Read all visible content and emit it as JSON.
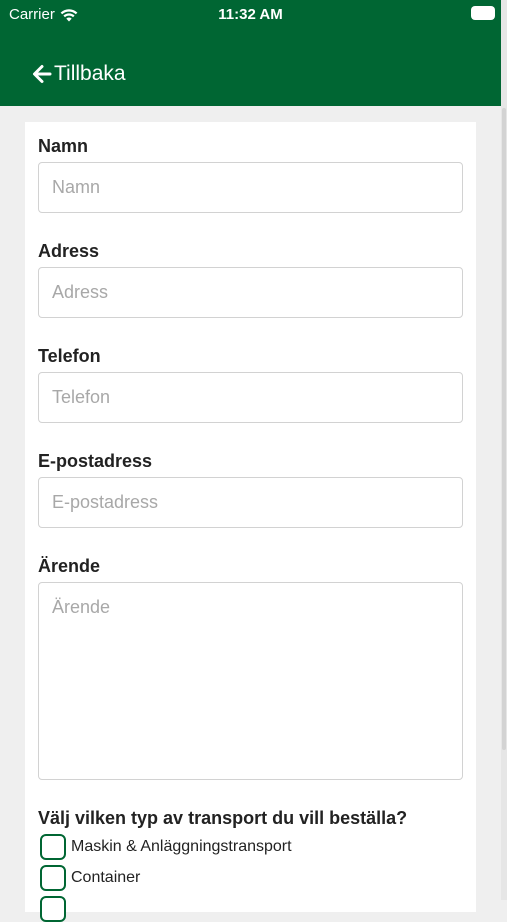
{
  "status_bar": {
    "carrier": "Carrier",
    "time": "11:32 AM",
    "wifi_icon": "wifi-icon",
    "battery_icon": "battery-icon"
  },
  "nav": {
    "back_label": "Tillbaka",
    "back_icon": "arrow-left-icon"
  },
  "form": {
    "fields": [
      {
        "label": "Namn",
        "placeholder": "Namn",
        "value": ""
      },
      {
        "label": "Adress",
        "placeholder": "Adress",
        "value": ""
      },
      {
        "label": "Telefon",
        "placeholder": "Telefon",
        "value": ""
      },
      {
        "label": "E-postadress",
        "placeholder": "E-postadress",
        "value": ""
      },
      {
        "label": "Ärende",
        "placeholder": "Ärende",
        "value": ""
      }
    ],
    "transport_question": "Välj vilken typ av transport du vill beställa?",
    "transport_options": [
      {
        "label": "Maskin & Anläggningstransport",
        "checked": false
      },
      {
        "label": "Container",
        "checked": false
      },
      {
        "label": "",
        "checked": false
      }
    ]
  },
  "colors": {
    "header_green": "#006633",
    "checkbox_border": "#006633",
    "card_background": "#ffffff",
    "page_background": "#efefef"
  }
}
